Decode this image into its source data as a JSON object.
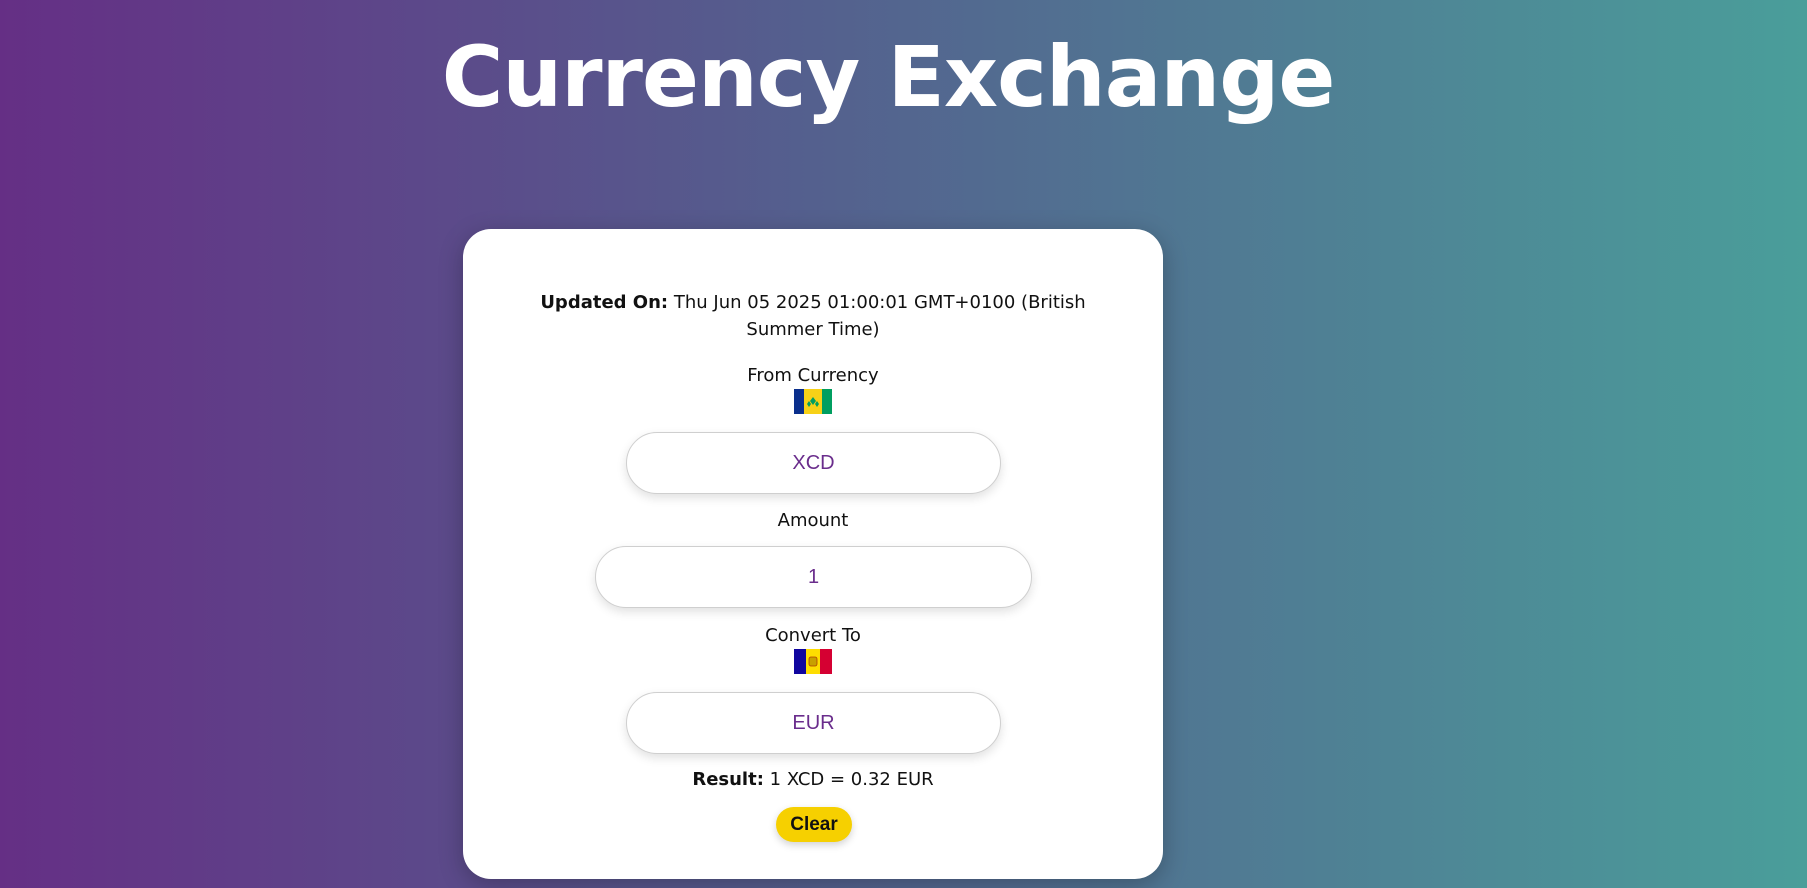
{
  "page": {
    "title": "Currency Exchange"
  },
  "updated": {
    "label": "Updated On:",
    "value": "Thu Jun 05 2025 01:00:01 GMT+0100 (British Summer Time)"
  },
  "from": {
    "label": "From Currency",
    "flag_icon": "saint-vincent-grenadines-flag-icon",
    "value": "XCD"
  },
  "amount": {
    "label": "Amount",
    "value": "1"
  },
  "to": {
    "label": "Convert To",
    "flag_icon": "andorra-flag-icon",
    "value": "EUR"
  },
  "result": {
    "label": "Result:",
    "value": "1 XCD = 0.32 EUR"
  },
  "actions": {
    "clear_label": "Clear"
  },
  "colors": {
    "gradient_start": "#652f85",
    "gradient_end": "#4a9e9a",
    "field_text": "#6a2d8c",
    "clear_button": "#f6d000"
  }
}
